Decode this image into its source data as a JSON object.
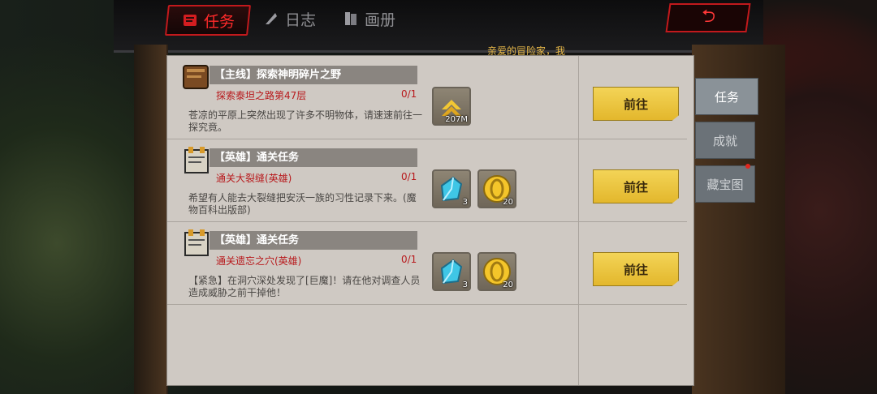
{
  "header": {
    "tabs": [
      {
        "label": "任务",
        "icon": "scroll-icon",
        "active": true
      },
      {
        "label": "日志",
        "icon": "feather-icon",
        "active": false
      },
      {
        "label": "画册",
        "icon": "book-icon",
        "active": false
      }
    ],
    "back_icon": "back-arrow-icon",
    "marquee": "亲爱的冒险家，我"
  },
  "tasks": [
    {
      "icon": "book-icon",
      "title": "【主线】探索神明碎片之野",
      "subtitle": "探索泰坦之路第47层",
      "progress": "0/1",
      "description": "苍凉的平原上突然出现了许多不明物体，请速速前往一探究竟。",
      "rewards": [
        {
          "icon": "rank-up-chevron-icon",
          "count": "207M"
        }
      ],
      "button": "前往"
    },
    {
      "icon": "notice-board-icon",
      "title": "【英雄】通关任务",
      "subtitle": "通关大裂缝(英雄)",
      "progress": "0/1",
      "description": "希望有人能去大裂缝把安沃一族的习性记录下来。(魔物百科出版部)",
      "rewards": [
        {
          "icon": "blue-crystal-icon",
          "count": "3"
        },
        {
          "icon": "gold-coin-icon",
          "count": "20"
        }
      ],
      "button": "前往"
    },
    {
      "icon": "notice-board-icon",
      "title": "【英雄】通关任务",
      "subtitle": "通关遗忘之穴(英雄)",
      "progress": "0/1",
      "description": "【紧急】在洞穴深处发现了[巨魔]！请在他对调查人员造成威胁之前干掉他！",
      "rewards": [
        {
          "icon": "blue-crystal-icon",
          "count": "3"
        },
        {
          "icon": "gold-coin-icon",
          "count": "20"
        }
      ],
      "button": "前往"
    }
  ],
  "side_tabs": [
    {
      "label": "任务",
      "active": true
    },
    {
      "label": "成就",
      "active": false
    },
    {
      "label": "藏宝图",
      "active": false,
      "notification": true
    }
  ],
  "colors": {
    "accent_red": "#c2191c",
    "go_button": "#f3d457",
    "panel": "#cfc9c3"
  }
}
